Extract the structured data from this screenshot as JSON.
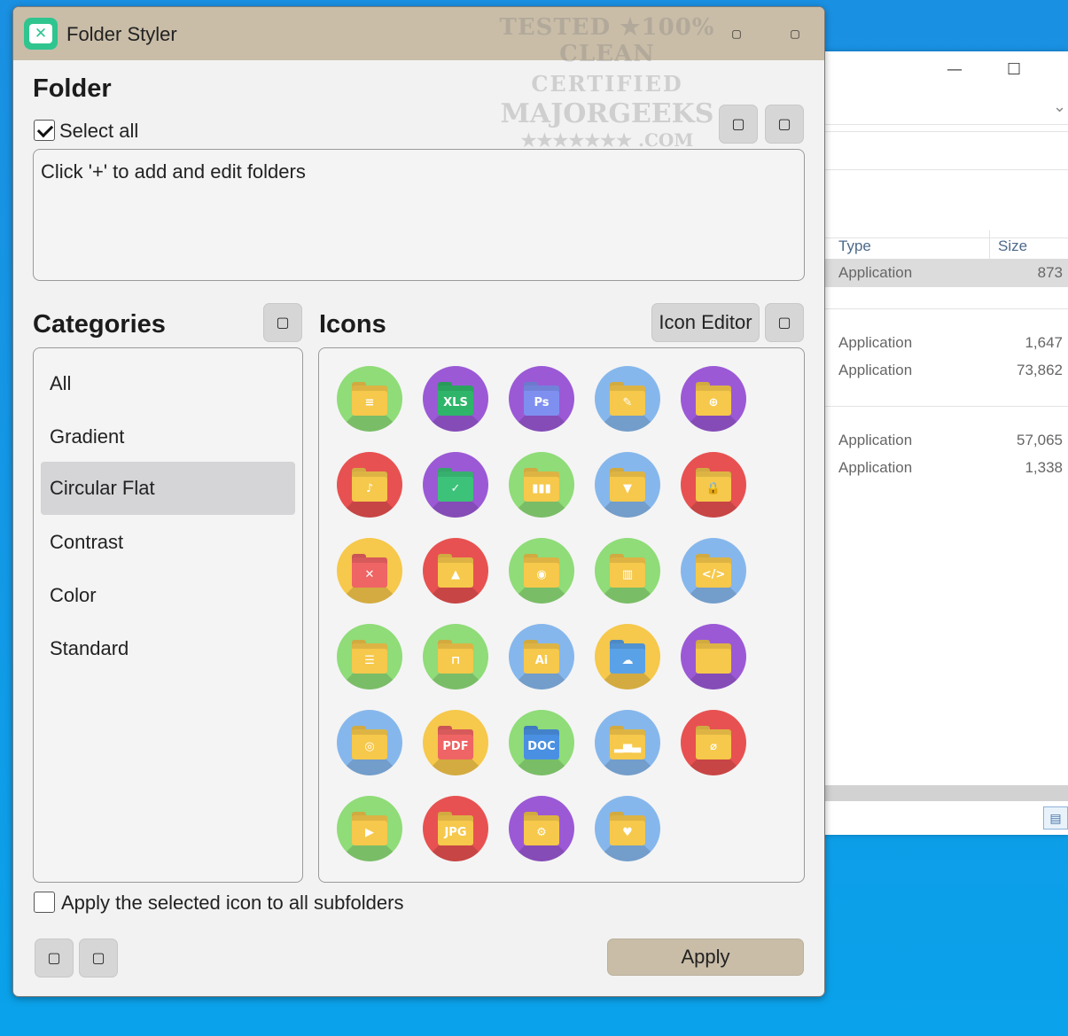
{
  "window": {
    "title": "Folder Styler",
    "title_buttons": [
      "▢",
      "▢"
    ]
  },
  "watermark": {
    "line1": "TESTED ★100% CLEAN",
    "line2": "CERTIFIED",
    "line3": "MAJORGEEKS",
    "line4": "★★★★★★★ .COM"
  },
  "folder_section": {
    "heading": "Folder",
    "select_all_label": "Select all",
    "select_all_checked": true,
    "action_buttons": [
      "▢",
      "▢"
    ],
    "box_text": "Click '+' to add and edit folders"
  },
  "categories": {
    "heading": "Categories",
    "header_button": "▢",
    "items": [
      {
        "label": "All",
        "active": false
      },
      {
        "label": "Gradient",
        "active": false
      },
      {
        "label": "Circular Flat",
        "active": true
      },
      {
        "label": "Contrast",
        "active": false
      },
      {
        "label": "Color",
        "active": false
      },
      {
        "label": "Standard",
        "active": false
      }
    ]
  },
  "icons_section": {
    "heading": "Icons",
    "editor_button": "Icon Editor",
    "header_button": "▢",
    "icons": [
      {
        "name": "document-folder-icon",
        "bg": "#8fdc78",
        "glyph": "≡",
        "front": "#f6c84b"
      },
      {
        "name": "xls-folder-icon",
        "bg": "#9b59d6",
        "glyph": "XLS",
        "front": "#2fb56a"
      },
      {
        "name": "photoshop-folder-icon",
        "bg": "#9b59d6",
        "glyph": "Ps",
        "front": "#7f8ff0"
      },
      {
        "name": "edit-folder-icon",
        "bg": "#86b7ec",
        "glyph": "✎",
        "front": "#f6c84b"
      },
      {
        "name": "web-folder-icon",
        "bg": "#9b59d6",
        "glyph": "⊕",
        "front": "#f6c84b"
      },
      {
        "name": "audio-folder-icon",
        "bg": "#e85151",
        "glyph": "♪",
        "front": "#f6c84b"
      },
      {
        "name": "check-folder-icon",
        "bg": "#9b59d6",
        "glyph": "✓",
        "front": "#3dc27a"
      },
      {
        "name": "books-folder-icon",
        "bg": "#8fdc78",
        "glyph": "▮▮▮",
        "front": "#f6c84b"
      },
      {
        "name": "bookmark-folder-icon",
        "bg": "#86b7ec",
        "glyph": "▼",
        "front": "#f6c84b"
      },
      {
        "name": "lock-folder-icon",
        "bg": "#e85151",
        "glyph": "🔒",
        "front": "#f6c84b"
      },
      {
        "name": "delete-folder-icon",
        "bg": "#f6c84b",
        "glyph": "✕",
        "front": "#ef6464"
      },
      {
        "name": "image-folder-icon",
        "bg": "#e85151",
        "glyph": "▲",
        "front": "#f6c84b"
      },
      {
        "name": "games-folder-icon",
        "bg": "#8fdc78",
        "glyph": "◉",
        "front": "#f6c84b"
      },
      {
        "name": "trash-folder-icon",
        "bg": "#8fdc78",
        "glyph": "▥",
        "front": "#f6c84b"
      },
      {
        "name": "code-folder-icon",
        "bg": "#86b7ec",
        "glyph": "</>",
        "front": "#f6c84b"
      },
      {
        "name": "cabinet-folder-icon",
        "bg": "#8fdc78",
        "glyph": "☰",
        "front": "#f6c84b"
      },
      {
        "name": "unlock-folder-icon",
        "bg": "#8fdc78",
        "glyph": "⊓",
        "front": "#f6c84b"
      },
      {
        "name": "illustrator-folder-icon",
        "bg": "#86b7ec",
        "glyph": "Ai",
        "front": "#f6c84b"
      },
      {
        "name": "cloud-folder-icon",
        "bg": "#f6c84b",
        "glyph": "☁",
        "front": "#5aa2e8"
      },
      {
        "name": "open-folder-icon",
        "bg": "#9b59d6",
        "glyph": "",
        "front": "#f6c84b"
      },
      {
        "name": "database-folder-icon",
        "bg": "#86b7ec",
        "glyph": "◎",
        "front": "#f6c84b"
      },
      {
        "name": "pdf-folder-icon",
        "bg": "#f6c84b",
        "glyph": "PDF",
        "front": "#ef6464"
      },
      {
        "name": "doc-folder-icon",
        "bg": "#8fdc78",
        "glyph": "DOC",
        "front": "#4a90e2"
      },
      {
        "name": "chart-folder-icon",
        "bg": "#86b7ec",
        "glyph": "▂▅▃",
        "front": "#f6c84b"
      },
      {
        "name": "attachment-folder-icon",
        "bg": "#e85151",
        "glyph": "⌀",
        "front": "#f6c84b"
      },
      {
        "name": "video-folder-icon",
        "bg": "#8fdc78",
        "glyph": "▶",
        "front": "#f6c84b"
      },
      {
        "name": "jpg-folder-icon",
        "bg": "#e85151",
        "glyph": "JPG",
        "front": "#f6c84b"
      },
      {
        "name": "settings-folder-icon",
        "bg": "#9b59d6",
        "glyph": "⚙",
        "front": "#f6c84b"
      },
      {
        "name": "favorite-folder-icon",
        "bg": "#86b7ec",
        "glyph": "♥",
        "front": "#f6c84b"
      }
    ]
  },
  "subfolders": {
    "label": "Apply the selected icon to all subfolders",
    "checked": false
  },
  "bottom_buttons": [
    "▢",
    "▢"
  ],
  "apply_label": "Apply",
  "explorer": {
    "minimize": "—",
    "maximize": "☐",
    "chevron": "⌄",
    "columns": {
      "type": "Type",
      "size": "Size"
    },
    "rows": [
      {
        "type": "Application",
        "size": "873",
        "selected": true
      },
      {
        "type": "Application",
        "size": "1,647",
        "selected": false
      },
      {
        "type": "Application",
        "size": "73,862",
        "selected": false
      },
      {
        "type": "Application",
        "size": "57,065",
        "selected": false
      },
      {
        "type": "Application",
        "size": "1,338",
        "selected": false
      }
    ],
    "view_icon": "▤"
  },
  "colors": {
    "titlebar": "#c9bda8",
    "accent": "#2fc58f",
    "selected_category": "#d5d5d8",
    "desktop": "#1a90e2"
  }
}
